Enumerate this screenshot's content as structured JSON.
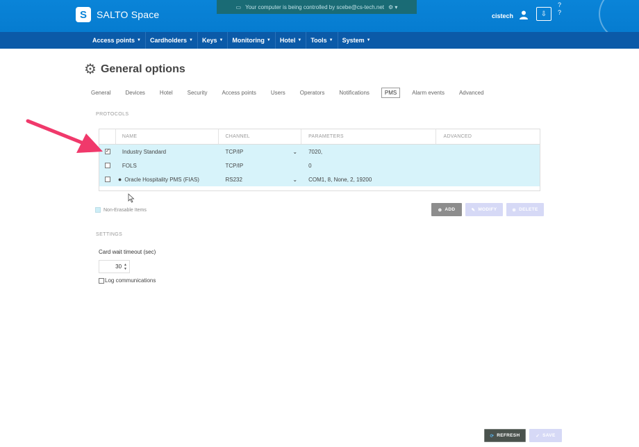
{
  "header": {
    "logo_mark": "S",
    "app_name": "SALTO Space",
    "remote_banner": "Your computer is being controlled by scebe@cs-tech.net",
    "username": "cistech",
    "help_top": "?",
    "help_bottom": "?"
  },
  "nav": {
    "items": [
      {
        "label": "Access points"
      },
      {
        "label": "Cardholders"
      },
      {
        "label": "Keys"
      },
      {
        "label": "Monitoring"
      },
      {
        "label": "Hotel"
      },
      {
        "label": "Tools"
      },
      {
        "label": "System"
      }
    ]
  },
  "page": {
    "title": "General options"
  },
  "tabs": [
    {
      "label": "General"
    },
    {
      "label": "Devices"
    },
    {
      "label": "Hotel"
    },
    {
      "label": "Security"
    },
    {
      "label": "Access points"
    },
    {
      "label": "Users"
    },
    {
      "label": "Operators"
    },
    {
      "label": "Notifications"
    },
    {
      "label": "PMS",
      "active": true
    },
    {
      "label": "Alarm events"
    },
    {
      "label": "Advanced"
    }
  ],
  "protocols": {
    "section_label": "PROTOCOLS",
    "columns": {
      "name": "NAME",
      "channel": "CHANNEL",
      "parameters": "PARAMETERS",
      "advanced": "ADVANCED"
    },
    "rows": [
      {
        "checked": true,
        "bullet": "",
        "name": "Industry Standard",
        "channel": "TCP/IP",
        "has_dropdown": true,
        "parameters": "7020,",
        "advanced": ""
      },
      {
        "checked": false,
        "bullet": "",
        "name": "FOLS",
        "channel": "TCP/IP",
        "has_dropdown": false,
        "parameters": "0",
        "advanced": ""
      },
      {
        "checked": false,
        "bullet": "●",
        "name": "Oracle Hospitality PMS (FIAS)",
        "channel": "RS232",
        "has_dropdown": true,
        "parameters": "COM1, 8, None, 2, 19200",
        "advanced": ""
      }
    ],
    "legend": "Non-Erasable Items",
    "buttons": {
      "add": "ADD",
      "modify": "MODIFY",
      "delete": "DELETE"
    }
  },
  "settings": {
    "section_label": "SETTINGS",
    "card_wait_label": "Card wait timeout (sec)",
    "card_wait_value": "30",
    "log_label": "Log communications",
    "log_checked": false
  },
  "footer": {
    "refresh": "REFRESH",
    "save": "SAVE"
  },
  "colors": {
    "header": "#0a84d8",
    "nav": "#0b5aa8",
    "row_highlight": "#d7f3fa",
    "annotation_arrow": "#f0396b"
  },
  "icons": [
    "logo-icon",
    "user-icon",
    "download-icon",
    "help-icon",
    "gear-icon",
    "plus-circle-icon",
    "pencil-icon",
    "x-circle-icon",
    "refresh-icon",
    "check-icon",
    "chevron-down-icon",
    "mouse-cursor-icon",
    "annotation-arrow-icon"
  ]
}
